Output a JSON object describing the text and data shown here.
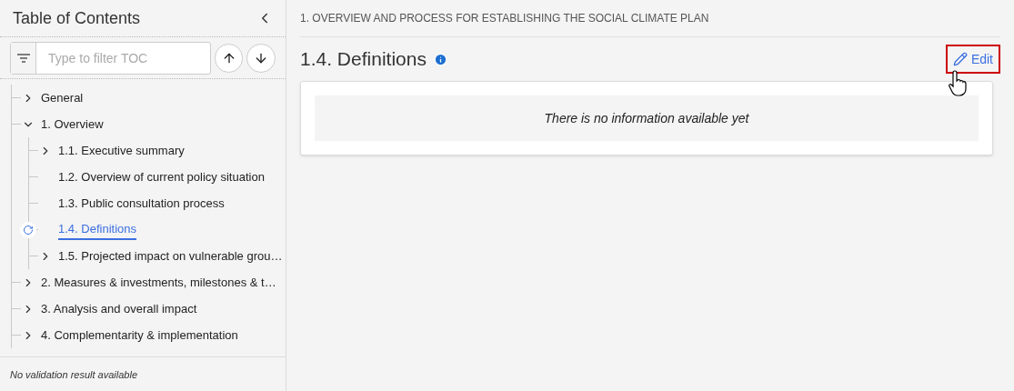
{
  "sidebar": {
    "title": "Table of Contents",
    "filter": {
      "placeholder": "Type to filter TOC"
    },
    "tree": [
      {
        "label": "General",
        "selected": false,
        "expanded": false
      },
      {
        "label": "1. Overview",
        "selected": false,
        "expanded": true,
        "children": [
          {
            "label": "1.1. Executive summary",
            "selected": false,
            "expanded": false
          },
          {
            "label": "1.2. Overview of current policy situation",
            "selected": false
          },
          {
            "label": "1.3. Public consultation process",
            "selected": false
          },
          {
            "label": "1.4. Definitions",
            "selected": true
          },
          {
            "label": "1.5. Projected impact on vulnerable grou…",
            "selected": false,
            "expanded": false
          }
        ]
      },
      {
        "label": "2. Measures & investments, milestones & t…",
        "selected": false,
        "expanded": false
      },
      {
        "label": "3. Analysis and overall impact",
        "selected": false,
        "expanded": false
      },
      {
        "label": "4. Complementarity & implementation",
        "selected": false,
        "expanded": false
      }
    ],
    "status": "No validation result available"
  },
  "main": {
    "breadcrumb": "1. OVERVIEW AND PROCESS FOR ESTABLISHING THE SOCIAL CLIMATE PLAN",
    "title": "1.4. Definitions",
    "edit_button": "Edit",
    "empty_message": "There is no information available yet"
  }
}
